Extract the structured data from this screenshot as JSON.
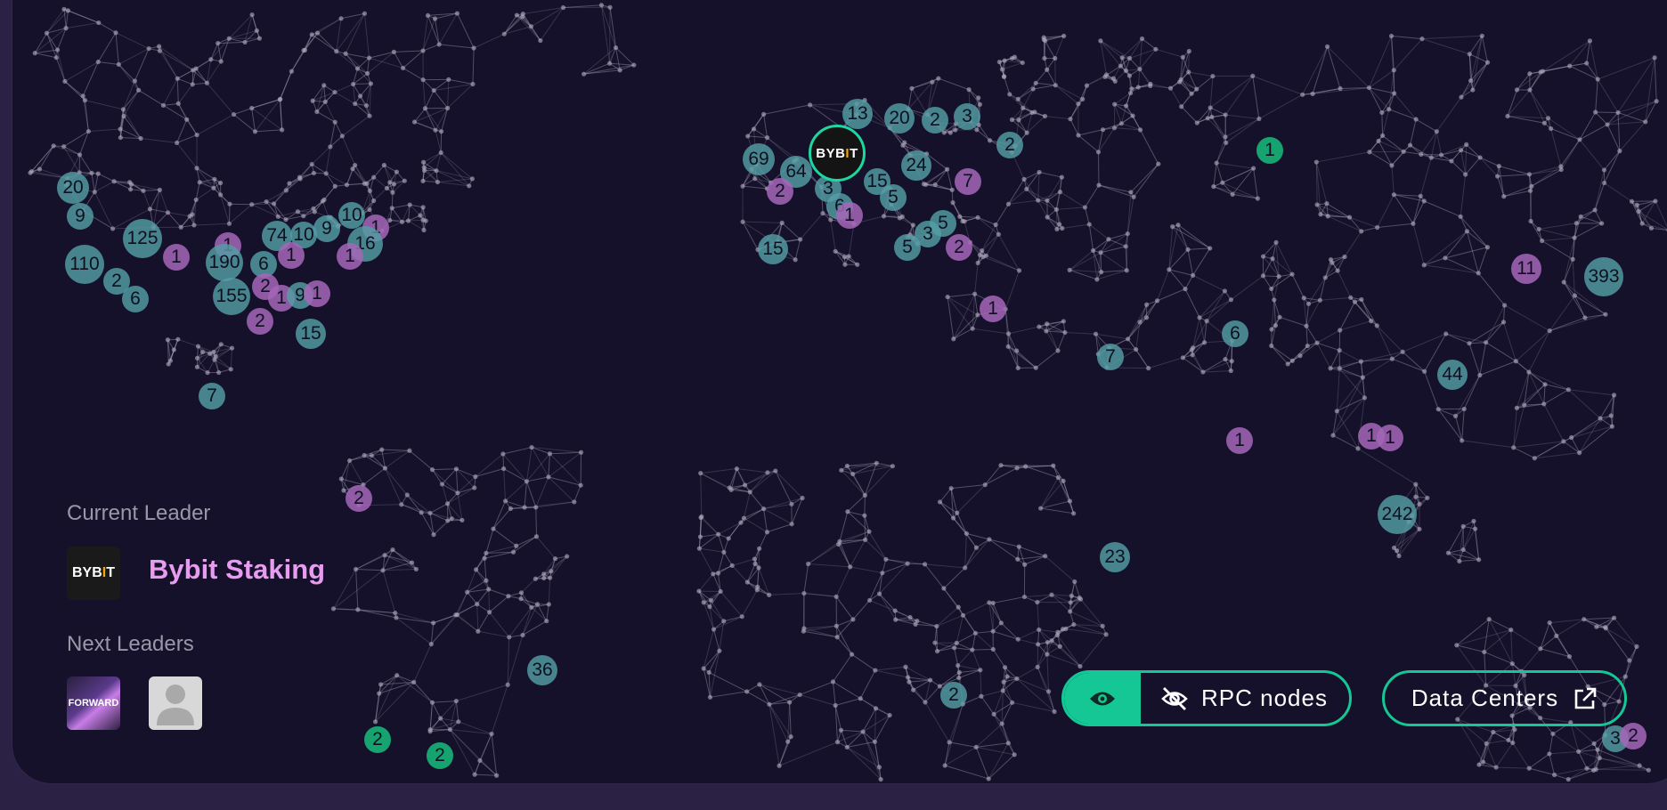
{
  "map": {
    "clusters": [
      {
        "v": "20",
        "c": "teal"
      },
      {
        "v": "9",
        "c": "teal"
      },
      {
        "v": "125",
        "c": "teal"
      },
      {
        "v": "1",
        "c": "purple"
      },
      {
        "v": "110",
        "c": "teal"
      },
      {
        "v": "2",
        "c": "teal"
      },
      {
        "v": "6",
        "c": "teal"
      },
      {
        "v": "1",
        "c": "purple"
      },
      {
        "v": "190",
        "c": "teal"
      },
      {
        "v": "6",
        "c": "teal"
      },
      {
        "v": "74",
        "c": "teal"
      },
      {
        "v": "10",
        "c": "teal"
      },
      {
        "v": "1",
        "c": "purple"
      },
      {
        "v": "9",
        "c": "teal"
      },
      {
        "v": "10",
        "c": "teal"
      },
      {
        "v": "1",
        "c": "purple"
      },
      {
        "v": "16",
        "c": "teal"
      },
      {
        "v": "1",
        "c": "purple"
      },
      {
        "v": "155",
        "c": "teal"
      },
      {
        "v": "2",
        "c": "purple"
      },
      {
        "v": "1",
        "c": "purple"
      },
      {
        "v": "9",
        "c": "teal"
      },
      {
        "v": "1",
        "c": "purple"
      },
      {
        "v": "2",
        "c": "purple"
      },
      {
        "v": "15",
        "c": "teal"
      },
      {
        "v": "7",
        "c": "teal"
      },
      {
        "v": "2",
        "c": "purple"
      },
      {
        "v": "36",
        "c": "teal"
      },
      {
        "v": "2",
        "c": "green"
      },
      {
        "v": "2",
        "c": "green"
      },
      {
        "v": "13",
        "c": "teal"
      },
      {
        "v": "20",
        "c": "teal"
      },
      {
        "v": "2",
        "c": "teal"
      },
      {
        "v": "3",
        "c": "teal"
      },
      {
        "v": "69",
        "c": "teal"
      },
      {
        "v": "64",
        "c": "teal"
      },
      {
        "v": "24",
        "c": "teal"
      },
      {
        "v": "2",
        "c": "teal"
      },
      {
        "v": "7",
        "c": "purple"
      },
      {
        "v": "2",
        "c": "purple"
      },
      {
        "v": "3",
        "c": "teal"
      },
      {
        "v": "6",
        "c": "teal"
      },
      {
        "v": "15",
        "c": "teal"
      },
      {
        "v": "5",
        "c": "teal"
      },
      {
        "v": "1",
        "c": "purple"
      },
      {
        "v": "15",
        "c": "teal"
      },
      {
        "v": "5",
        "c": "teal"
      },
      {
        "v": "3",
        "c": "teal"
      },
      {
        "v": "5",
        "c": "teal"
      },
      {
        "v": "2",
        "c": "purple"
      },
      {
        "v": "1",
        "c": "purple"
      },
      {
        "v": "1",
        "c": "green"
      },
      {
        "v": "11",
        "c": "purple"
      },
      {
        "v": "393",
        "c": "teal"
      },
      {
        "v": "6",
        "c": "teal"
      },
      {
        "v": "7",
        "c": "teal"
      },
      {
        "v": "44",
        "c": "teal"
      },
      {
        "v": "1",
        "c": "purple"
      },
      {
        "v": "1",
        "c": "purple"
      },
      {
        "v": "1",
        "c": "purple"
      },
      {
        "v": "242",
        "c": "teal"
      },
      {
        "v": "23",
        "c": "teal"
      },
      {
        "v": "2",
        "c": "teal"
      },
      {
        "v": "3",
        "c": "teal"
      },
      {
        "v": "2",
        "c": "purple"
      }
    ],
    "leader_marker": {
      "logo_text_a": "BYB",
      "logo_text_b": "I",
      "logo_text_c": "T"
    }
  },
  "current_leader": {
    "label": "Current Leader",
    "name": "Bybit Staking",
    "logo_a": "BYB",
    "logo_b": "I",
    "logo_c": "T"
  },
  "next_leaders": {
    "label": "Next Leaders",
    "logos": [
      {
        "text": "FORWARD"
      },
      {
        "text": ""
      }
    ]
  },
  "controls": {
    "rpc_toggle_label": "RPC nodes",
    "data_centers_label": "Data Centers"
  },
  "colors": {
    "background": "#15112a",
    "accent": "#15c795",
    "teal_cluster": "#549da5",
    "purple_cluster": "#a566b8",
    "leader_name": "#e79cf0"
  }
}
